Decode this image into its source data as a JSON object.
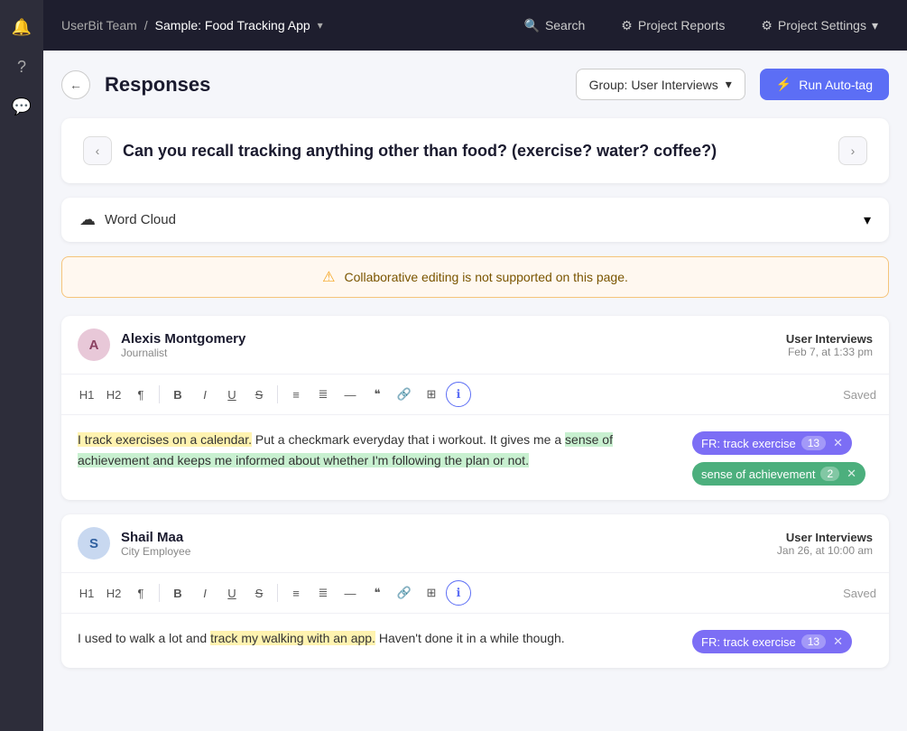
{
  "sidebar": {
    "icons": [
      {
        "name": "bell-icon",
        "symbol": "🔔"
      },
      {
        "name": "help-icon",
        "symbol": "?"
      },
      {
        "name": "chat-icon",
        "symbol": "💬"
      }
    ]
  },
  "topnav": {
    "team": "UserBit Team",
    "separator": "/",
    "project": "Sample: Food Tracking App",
    "arrow": "▾",
    "search_label": "Search",
    "reports_label": "Project Reports",
    "settings_label": "Project Settings",
    "settings_arrow": "▾"
  },
  "header": {
    "back_label": "←",
    "title": "Responses",
    "group_label": "Group: User Interviews",
    "group_arrow": "▾",
    "autotag_icon": "⚡",
    "autotag_label": "Run Auto-tag"
  },
  "question": {
    "prev_arrow": "‹",
    "next_arrow": "›",
    "text": "Can you recall tracking anything other than food? (exercise? water? coffee?)"
  },
  "word_cloud": {
    "icon": "☁",
    "label": "Word Cloud",
    "chevron": "▾"
  },
  "warning": {
    "icon": "⚠",
    "text": "Collaborative editing is not supported on this page."
  },
  "responses": [
    {
      "id": "alexis",
      "avatar_letter": "A",
      "avatar_class": "avatar-a",
      "name": "Alexis Montgomery",
      "role": "Journalist",
      "source": "User Interviews",
      "date": "Feb 7, at 1:33 pm",
      "saved": "Saved",
      "content_before": "I track exercises on a calendar.",
      "content_mid": " Put a checkmark everyday that i workout. It gives me a ",
      "highlight1": "sense of achievement and keeps me informed about whether I'm following the plan or not.",
      "tags": [
        {
          "label": "FR: track exercise",
          "count": "13",
          "color": "tag-purple"
        },
        {
          "label": "sense of achievement",
          "count": "2",
          "color": "tag-green"
        }
      ]
    },
    {
      "id": "shail",
      "avatar_letter": "S",
      "avatar_class": "avatar-s",
      "name": "Shail Maa",
      "role": "City Employee",
      "source": "User Interviews",
      "date": "Jan 26, at 10:00 am",
      "saved": "Saved",
      "content_before": "I used to walk a lot and ",
      "highlight1": "track my walking with an app.",
      "content_after": " Haven't done it in a while though.",
      "tags": [
        {
          "label": "FR: track exercise",
          "count": "13",
          "color": "tag-purple"
        }
      ]
    }
  ],
  "toolbar": {
    "h1": "H1",
    "h2": "H2",
    "paragraph": "¶",
    "bold": "B",
    "italic": "I",
    "underline": "U",
    "strikethrough": "S",
    "bullet": "≡",
    "ordered": "≣",
    "divider": "—",
    "quote": "❝",
    "link": "🔗",
    "table": "⊞",
    "info": "ℹ"
  }
}
